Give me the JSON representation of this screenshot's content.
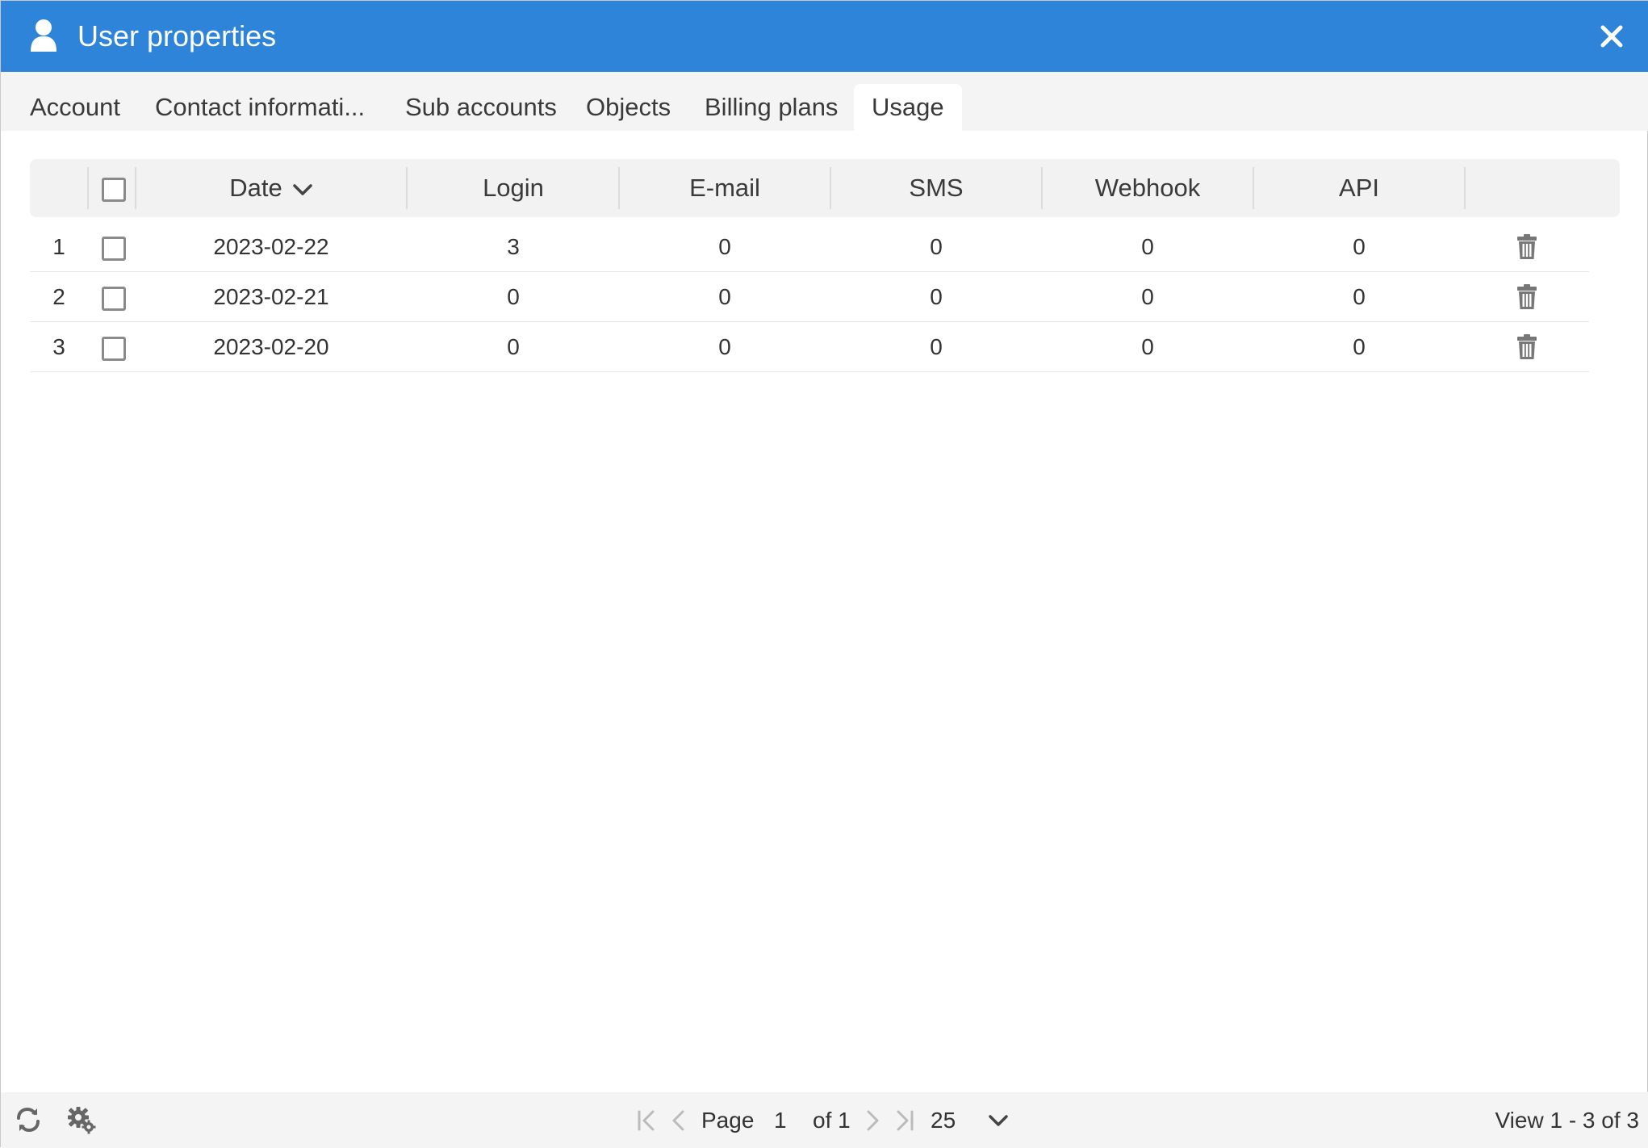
{
  "window": {
    "title": "User properties",
    "icon": "user-icon",
    "close_icon": "close-icon",
    "accent_color": "#2d84d8"
  },
  "tabs": [
    {
      "label": "Account",
      "active": false
    },
    {
      "label": "Contact informati...",
      "active": false
    },
    {
      "label": "Sub accounts",
      "active": false
    },
    {
      "label": "Objects",
      "active": false
    },
    {
      "label": "Billing plans",
      "active": false
    },
    {
      "label": "Usage",
      "active": true
    }
  ],
  "grid": {
    "columns": [
      "Date",
      "Login",
      "E-mail",
      "SMS",
      "Webhook",
      "API"
    ],
    "sort_column": "Date",
    "sort_direction": "desc",
    "rows": [
      {
        "num": "1",
        "date": "2023-02-22",
        "login": "3",
        "email": "0",
        "sms": "0",
        "webhook": "0",
        "api": "0"
      },
      {
        "num": "2",
        "date": "2023-02-21",
        "login": "0",
        "email": "0",
        "sms": "0",
        "webhook": "0",
        "api": "0"
      },
      {
        "num": "3",
        "date": "2023-02-20",
        "login": "0",
        "email": "0",
        "sms": "0",
        "webhook": "0",
        "api": "0"
      }
    ]
  },
  "footer": {
    "page_label": "Page",
    "page_value": "1",
    "page_of": "of 1",
    "rows_per_page": "25",
    "view_text": "View 1 - 3 of 3"
  }
}
